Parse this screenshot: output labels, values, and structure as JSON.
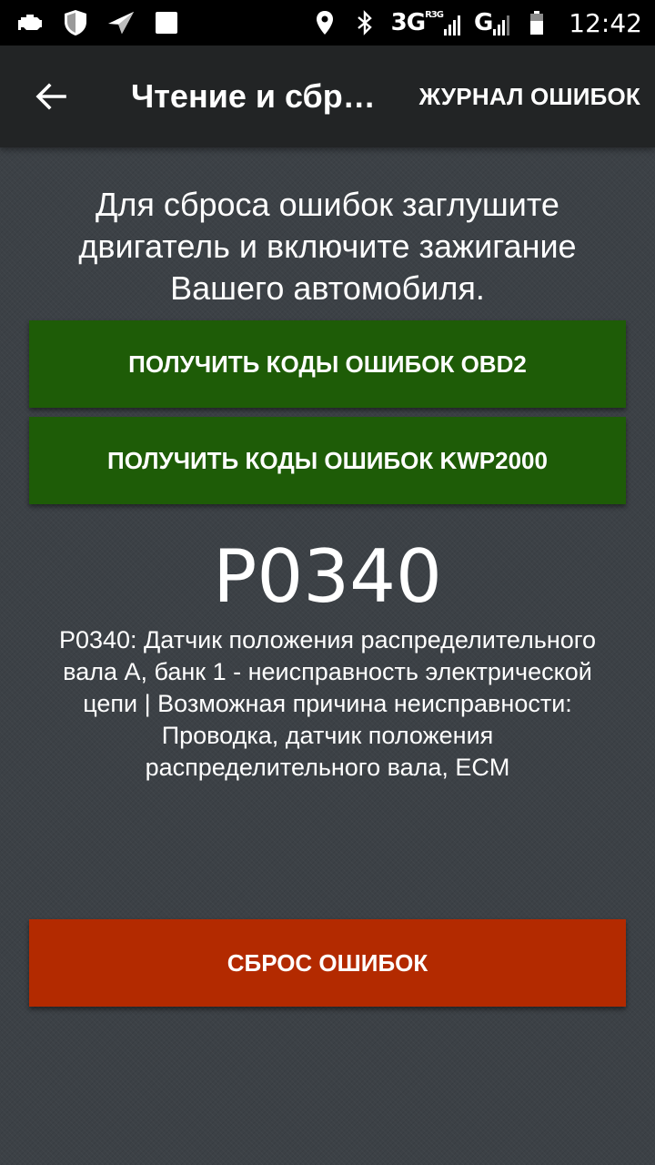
{
  "status_bar": {
    "left_icons": [
      "engine-icon",
      "shield-icon",
      "navigation-arrow-icon",
      "square-icon"
    ],
    "right_icons": [
      "location-pin-icon",
      "bluetooth-icon",
      "signal-icon",
      "battery-icon"
    ],
    "network_1": "3G",
    "network_1_badge": "R3G",
    "network_2": "G",
    "time": "12:42"
  },
  "app_bar": {
    "title": "Чтение и сбр…",
    "action": "ЖУРНАЛ ОШИБОК",
    "back_icon": "arrow-left-icon"
  },
  "main": {
    "instruction": "Для сброса ошибок заглушите двигатель и включите зажигание Вашего автомобиля.",
    "obd_button": "ПОЛУЧИТЬ КОДЫ ОШИБОК OBD2",
    "kwp_button": "ПОЛУЧИТЬ КОДЫ ОШИБОК KWP2000",
    "error_code": "P0340",
    "error_description": "P0340: Датчик положения распределительного вала A, банк 1 - неисправность электрической цепи | Возможная причина неисправности: Проводка, датчик положения распределительного вала, ECM",
    "reset_button": "СБРОС ОШИБОК"
  },
  "colors": {
    "background": "#3c4146",
    "app_bar": "#222425",
    "green_button": "#1e5c07",
    "reset_button": "#b32a00"
  }
}
